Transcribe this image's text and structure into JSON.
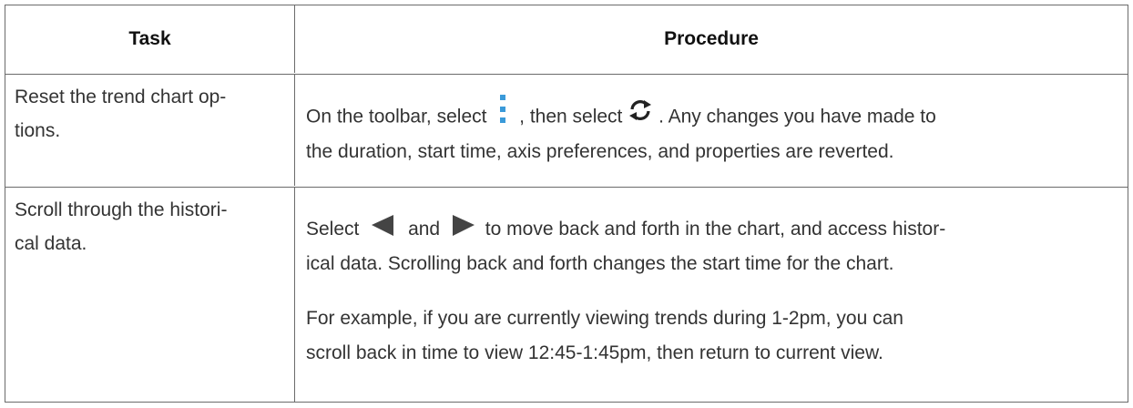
{
  "table": {
    "headers": {
      "task": "Task",
      "procedure": "Procedure"
    },
    "rows": [
      {
        "task_lines": [
          "Reset the trend chart op-",
          "tions."
        ],
        "procedure": {
          "l1_a": "On the toolbar, select",
          "l1_b": ", then select",
          "l1_c": ". Any changes you have made to",
          "l2": "the duration, start time, axis preferences, and properties are reverted."
        }
      },
      {
        "task_lines": [
          "Scroll through the histori-",
          "cal data."
        ],
        "procedure": {
          "p1_l1_a": "Select",
          "p1_l1_b": "and",
          "p1_l1_c": "to move back and forth in the chart, and access histor-",
          "p1_l2": "ical data. Scrolling back and forth changes the start time for the chart.",
          "p2_l1": "For example, if you are currently viewing trends during 1-2pm, you can",
          "p2_l2": "scroll back in time to view 12:45-1:45pm, then return to current view."
        }
      }
    ]
  },
  "icons": {
    "kebab": "vertical-ellipsis-menu-icon",
    "refresh": "refresh-icon",
    "left": "scroll-left-arrow-icon",
    "right": "scroll-right-arrow-icon"
  },
  "colors": {
    "kebab": "#3a9ad9",
    "arrows": "#444444",
    "border": "#6b6b6b"
  }
}
